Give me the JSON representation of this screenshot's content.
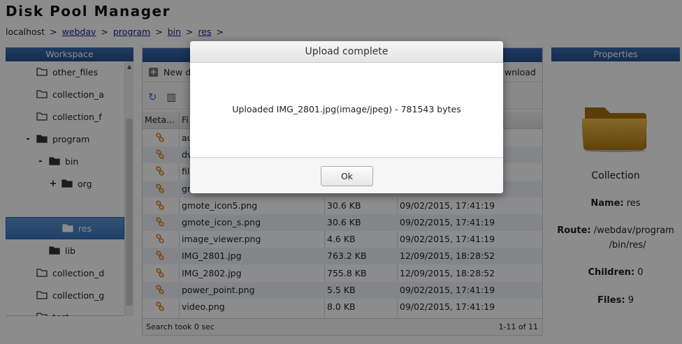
{
  "app": {
    "title": "Disk Pool Manager"
  },
  "breadcrumb": {
    "root": "localhost",
    "links": [
      "webdav",
      "program",
      "bin",
      "res"
    ],
    "separator": ">"
  },
  "workspace": {
    "header": "Workspace",
    "items": [
      {
        "label": "other_files",
        "toggle": ""
      },
      {
        "label": "collection_a",
        "toggle": ""
      },
      {
        "label": "collection_f",
        "toggle": ""
      },
      {
        "label": "program",
        "toggle": "-"
      },
      {
        "label": "bin",
        "toggle": "-"
      },
      {
        "label": "org",
        "toggle": "+"
      },
      {
        "label": "res",
        "toggle": "",
        "selected": true
      },
      {
        "label": "lib",
        "toggle": ""
      },
      {
        "label": "collection_d",
        "toggle": ""
      },
      {
        "label": "collection_g",
        "toggle": ""
      },
      {
        "label": "test",
        "toggle": ""
      }
    ]
  },
  "files": {
    "toolbar": {
      "new_label": "New d",
      "download_label": "wnload"
    },
    "columns": {
      "meta": "Meta...",
      "name": "Fi"
    },
    "rows": [
      {
        "name": "au",
        "size": "",
        "modified": ""
      },
      {
        "name": "dv",
        "size": "",
        "modified": ""
      },
      {
        "name": "fil",
        "size": "",
        "modified": ""
      },
      {
        "name": "gr",
        "size": "",
        "modified": ""
      },
      {
        "name": "gmote_icon5.png",
        "size": "30.6 KB",
        "modified": "09/02/2015, 17:41:19"
      },
      {
        "name": "gmote_icon_s.png",
        "size": "30.6 KB",
        "modified": "09/02/2015, 17:41:19"
      },
      {
        "name": "image_viewer.png",
        "size": "4.6 KB",
        "modified": "09/02/2015, 17:41:19"
      },
      {
        "name": "IMG_2801.jpg",
        "size": "763.2 KB",
        "modified": "12/09/2015, 18:28:52"
      },
      {
        "name": "IMG_2802.jpg",
        "size": "755.8 KB",
        "modified": "12/09/2015, 18:28:52"
      },
      {
        "name": "power_point.png",
        "size": "5.5 KB",
        "modified": "09/02/2015, 17:41:19"
      },
      {
        "name": "video.png",
        "size": "8.0 KB",
        "modified": "09/02/2015, 17:41:19"
      }
    ],
    "status_left": "Search took 0 sec",
    "status_right": "1-11 of 11"
  },
  "properties": {
    "header": "Properties",
    "type": "Collection",
    "name_label": "Name:",
    "name_value": "res",
    "route_label": "Route:",
    "route_value_1": "/webdav/program",
    "route_value_2": "/bin/res/",
    "children_label": "Children:",
    "children_value": "0",
    "files_label": "Files:",
    "files_value": "9"
  },
  "dialog": {
    "title": "Upload complete",
    "message": "Uploaded IMG_2801.jpg(image/jpeg) - 781543 bytes",
    "ok_label": "Ok"
  },
  "colors": {
    "header_blue": "#2b5797",
    "folder_gold": "#d9a520",
    "link_orange": "#e08a2c"
  }
}
